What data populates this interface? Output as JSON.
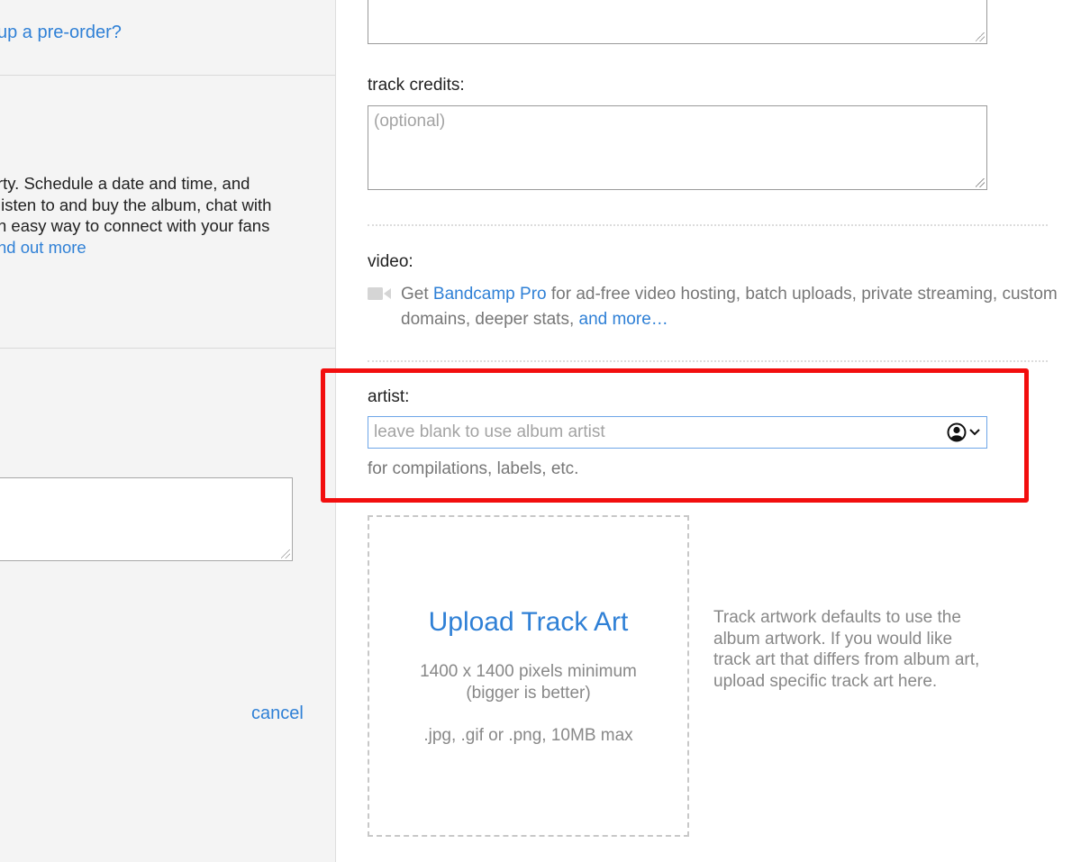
{
  "left": {
    "preorder_link": "up a pre-order?",
    "party_lines": [
      "rty. Schedule a date and time, and",
      "listen to and buy the album, chat with",
      "n easy way to connect with your fans"
    ],
    "find_out_more": "nd out more",
    "cancel_label": "cancel"
  },
  "right": {
    "track_credits_label": "track credits:",
    "track_credits_placeholder": "(optional)",
    "video_label": "video:",
    "video_pre": "Get ",
    "video_pro_link": "Bandcamp Pro",
    "video_mid": " for ad-free video hosting, batch uploads, private streaming, custom domains, deeper stats, ",
    "video_more_link": "and more…",
    "artist_label": "artist:",
    "artist_placeholder": "leave blank to use album artist",
    "artist_help": "for compilations, labels, etc.",
    "upload_title": "Upload Track Art",
    "upload_size_line1": "1400 x 1400 pixels minimum",
    "upload_size_line2": "(bigger is better)",
    "upload_formats": ".jpg, .gif or .png, 10MB max",
    "art_note": "Track artwork defaults to use the album artwork. If you would like track art that differs from album art, upload specific track art here."
  },
  "icons": [
    "video-camera-icon",
    "user-circle-icon",
    "chevron-down-icon"
  ],
  "colors": {
    "link": "#2f80d6",
    "highlight": "#f20e0e",
    "input_focus": "#6ea6e8"
  }
}
